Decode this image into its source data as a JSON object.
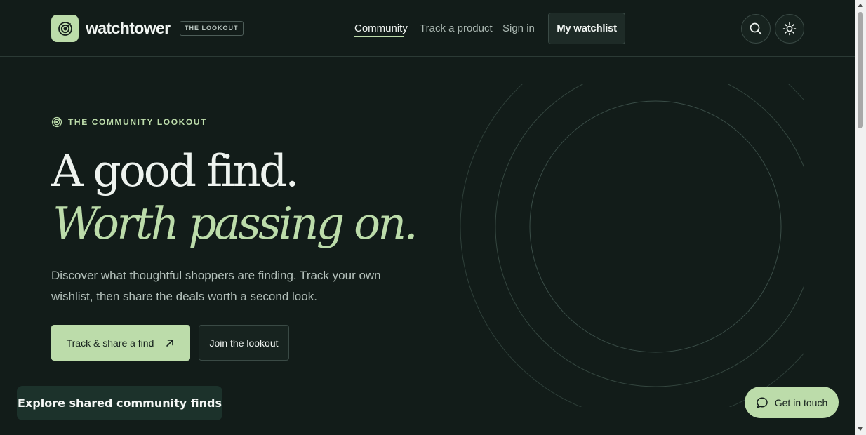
{
  "header": {
    "brand_name": "watchtower",
    "brand_tag": "THE LOOKOUT",
    "nav": [
      {
        "label": "Community",
        "active": true
      },
      {
        "label": "Track a product",
        "active": false
      },
      {
        "label": "Sign in",
        "active": false
      }
    ],
    "watchlist_label": "My watchlist",
    "search_icon": "search-icon",
    "theme_icon": "sun-icon"
  },
  "hero": {
    "eyebrow": "THE COMMUNITY LOOKOUT",
    "headline_line1": "A good find.",
    "headline_line2": "Worth passing on.",
    "subtitle": "Discover what thoughtful shoppers are finding. Track your own wishlist, then share the deals worth a second look.",
    "primary_cta": "Track & share a find",
    "secondary_cta": "Join the lookout"
  },
  "explore_label": "Explore shared community finds",
  "contact_label": "Get in touch",
  "colors": {
    "background": "#121c19",
    "accent": "#bcdcaa",
    "text": "#e8efe9",
    "muted": "#a9b6b0"
  }
}
